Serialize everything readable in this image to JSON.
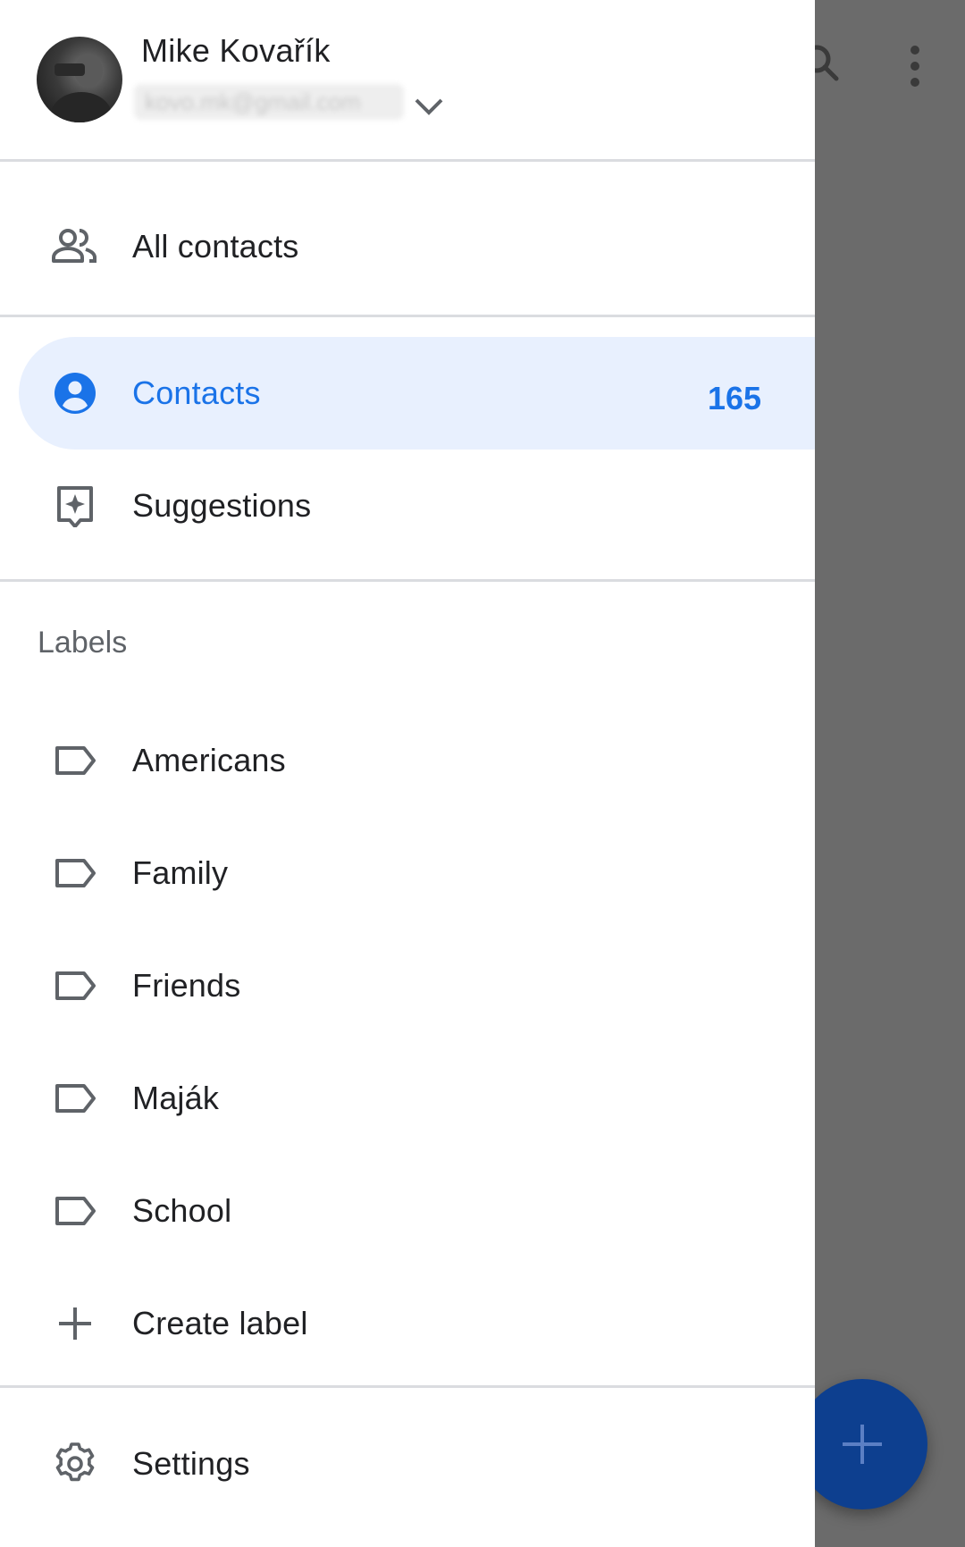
{
  "account": {
    "name": "Mike Kovařík",
    "email": "kovo.mk@gmail.com"
  },
  "nav": {
    "all_contacts": "All contacts",
    "contacts": "Contacts",
    "contacts_count": "165",
    "suggestions": "Suggestions"
  },
  "labels_section": {
    "title": "Labels",
    "items": [
      "Americans",
      "Family",
      "Friends",
      "Maják",
      "School"
    ],
    "create": "Create label"
  },
  "settings": "Settings",
  "colors": {
    "accent": "#1a73e8",
    "active_bg": "#e8f0fe",
    "fab": "#0d3f8f",
    "scrim": "#6b6b6b"
  },
  "icons": {
    "all_contacts": "people-icon",
    "contacts": "account-circle-icon",
    "suggestions": "sparkle-box-icon",
    "label": "label-outline-icon",
    "create": "plus-icon",
    "settings": "gear-icon",
    "fab": "plus-icon",
    "search": "search-icon",
    "more": "more-vertical-icon",
    "account_switch": "chevron-down-icon"
  }
}
